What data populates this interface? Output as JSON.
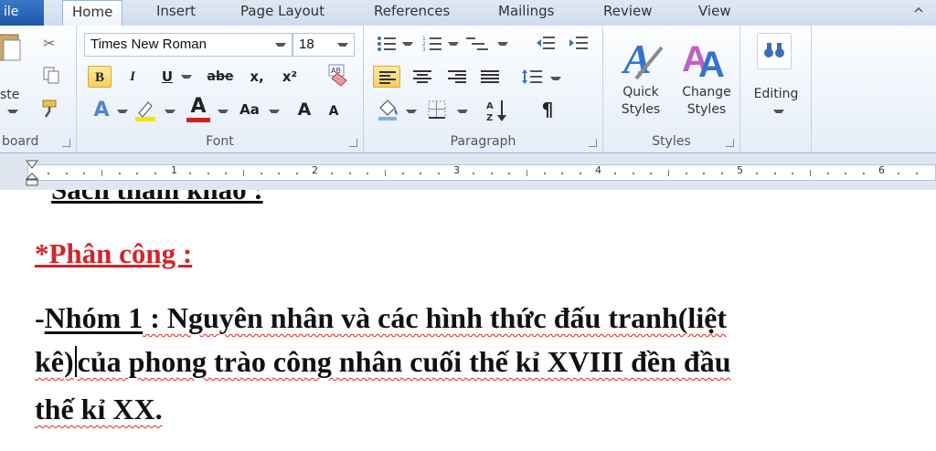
{
  "tabs": {
    "file": "ile",
    "items": [
      "Home",
      "Insert",
      "Page Layout",
      "References",
      "Mailings",
      "Review",
      "View"
    ]
  },
  "ribbon": {
    "clipboard": {
      "paste_label": "ste",
      "group_label": "board"
    },
    "font": {
      "font_name": "Times New Roman",
      "font_size": "18",
      "group_label": "Font",
      "bold": "B",
      "italic": "I",
      "underline": "U",
      "strike": "abe",
      "subscript": "x,",
      "superscript": "x²",
      "change_case": "Aa",
      "grow": "A",
      "shrink": "A",
      "highlight_color": "#f5e200",
      "font_color": "#d0201e"
    },
    "paragraph": {
      "group_label": "Paragraph",
      "pilcrow": "¶"
    },
    "styles": {
      "group_label": "Styles",
      "quick_styles": [
        "Quick",
        "Styles"
      ],
      "change_styles": [
        "Change",
        "Styles"
      ]
    },
    "editing": {
      "label": "Editing"
    }
  },
  "ruler": {
    "numbers": [
      "1",
      "2",
      "3",
      "4",
      "5",
      "6"
    ]
  },
  "document": {
    "cut_line": "Sách tham khảo :",
    "heading": "*Phân công :",
    "para1": {
      "dash": "-",
      "group": "Nhóm 1",
      "rest": " : Nguyên nhân và các hình thức đấu tranh(liệt"
    },
    "para2": {
      "before_caret": "kê)",
      "after_caret": "của phong trào công nhân cuối thế kỉ XVIII đền đầu"
    },
    "para3": "thế kỉ XX."
  }
}
